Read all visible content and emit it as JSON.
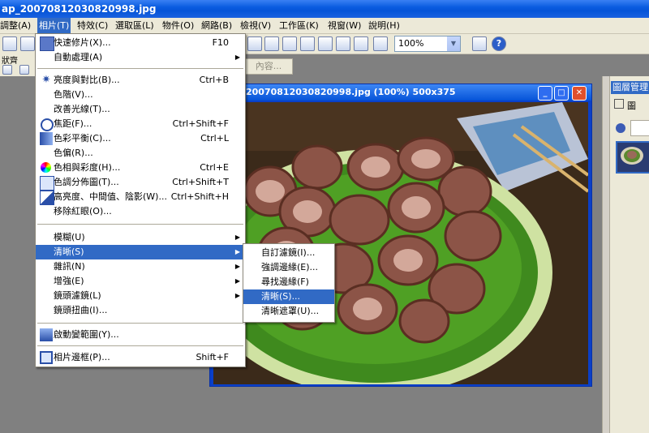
{
  "window": {
    "title": "ap_20070812030820998.jpg"
  },
  "menubar": {
    "items": [
      {
        "label": "調整(A)"
      },
      {
        "label": "相片(T)"
      },
      {
        "label": "特效(C)"
      },
      {
        "label": "選取區(L)"
      },
      {
        "label": "物件(O)"
      },
      {
        "label": "網路(B)"
      },
      {
        "label": "檢視(V)"
      },
      {
        "label": "工作區(K)"
      },
      {
        "label": "視窗(W)"
      },
      {
        "label": "說明(H)"
      }
    ]
  },
  "toolbar": {
    "zoom_value": "100%"
  },
  "toolbar2": {
    "partial_label": "狀齊",
    "content_button": "內容..."
  },
  "image_window": {
    "title": "20070812030820998.jpg (100%) 500x375"
  },
  "right_panel": {
    "header": "圖層管理",
    "tab_label": "圖"
  },
  "photo_menu": {
    "items": [
      {
        "label": "快速修片(X)...",
        "shortcut": "F10",
        "icon": "quick-fix-icon"
      },
      {
        "label": "自動處理(A)",
        "submenu": true
      },
      {
        "label": "亮度與對比(B)...",
        "shortcut": "Ctrl+B",
        "icon": "brightness-icon"
      },
      {
        "label": "色階(V)..."
      },
      {
        "label": "改善光線(T)..."
      },
      {
        "label": "焦距(F)...",
        "shortcut": "Ctrl+Shift+F",
        "icon": "focus-icon"
      },
      {
        "label": "色彩平衡(C)...",
        "shortcut": "Ctrl+L",
        "icon": "color-balance-icon"
      },
      {
        "label": "色偏(R)..."
      },
      {
        "label": "色相與彩度(H)...",
        "shortcut": "Ctrl+E",
        "icon": "hue-saturation-icon"
      },
      {
        "label": "色調分佈圖(T)...",
        "shortcut": "Ctrl+Shift+T",
        "icon": "histogram-icon"
      },
      {
        "label": "高亮度、中間值、陰影(W)...",
        "shortcut": "Ctrl+Shift+H",
        "icon": "highlight-shadow-icon"
      },
      {
        "label": "移除紅眼(O)..."
      },
      {
        "label": "模糊(U)",
        "submenu": true
      },
      {
        "label": "清晰(S)",
        "submenu": true
      },
      {
        "label": "雜訊(N)",
        "submenu": true
      },
      {
        "label": "增強(E)",
        "submenu": true
      },
      {
        "label": "鏡頭濾鏡(L)",
        "submenu": true
      },
      {
        "label": "鏡頭扭曲(I)..."
      },
      {
        "label": "啟動變範圍(Y)...",
        "icon": "dynamic-range-icon"
      },
      {
        "label": "相片邊框(P)...",
        "shortcut": "Shift+F",
        "icon": "photo-frame-icon"
      }
    ]
  },
  "sharpen_submenu": {
    "items": [
      {
        "label": "自訂濾鏡(I)..."
      },
      {
        "label": "強調邊緣(E)..."
      },
      {
        "label": "尋找邊緣(F)"
      },
      {
        "label": "清晰(S)..."
      },
      {
        "label": "清晰遮罩(U)..."
      }
    ]
  }
}
